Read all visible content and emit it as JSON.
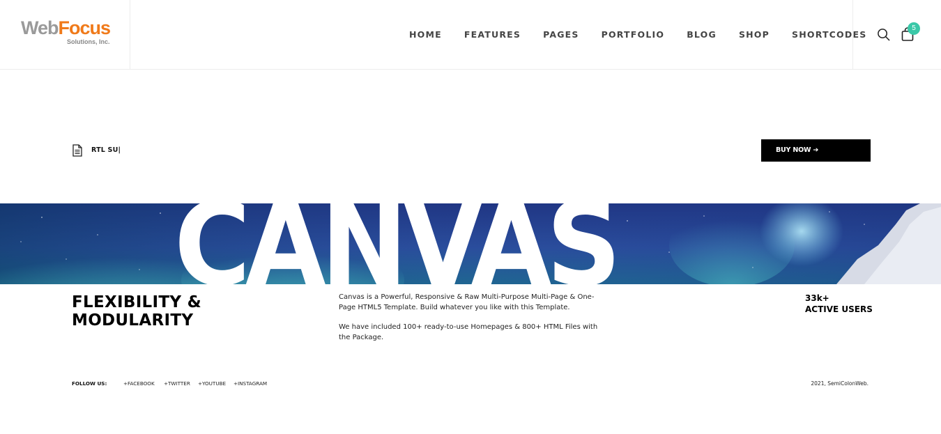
{
  "brand": {
    "logo_primary": "Web",
    "logo_accent": "Focus",
    "logo_sub": "Solutions, Inc."
  },
  "nav": {
    "items": [
      {
        "label": "HOME"
      },
      {
        "label": "FEATURES"
      },
      {
        "label": "PAGES"
      },
      {
        "label": "PORTFOLIO"
      },
      {
        "label": "BLOG"
      },
      {
        "label": "SHOP"
      },
      {
        "label": "SHORTCODES"
      }
    ]
  },
  "header_icons": {
    "search": "search-icon",
    "cart": "shopping-bag-icon",
    "cart_count": "5"
  },
  "top_row": {
    "doc_icon": "document-icon",
    "rtl_text": "RTL SU|",
    "buy_button": "BUY NOW ➔"
  },
  "hero": {
    "word": "CANVAS"
  },
  "content": {
    "title_line1": "FLEXIBILITY &",
    "title_line2": "MODULARITY",
    "para1": "Canvas is a Powerful, Responsive & Raw Multi-Purpose Multi-Page & One-Page HTML5 Template. Build whatever you like with this Template.",
    "para2": "We have included 100+ ready-to-use Homepages & 800+ HTML Files with the Package.",
    "users_count": "33k+",
    "users_label": "ACTIVE USERS"
  },
  "footer": {
    "follow_label": "FOLLOW US:",
    "social": [
      "+FACEBOOK",
      "+TWITTER",
      "+YOUTUBE",
      "+INSTAGRAM"
    ],
    "copyright": "2021, SemiColonWeb."
  },
  "colors": {
    "accent": "#f07a1a",
    "badge": "#3ac8a8",
    "button": "#000000"
  }
}
